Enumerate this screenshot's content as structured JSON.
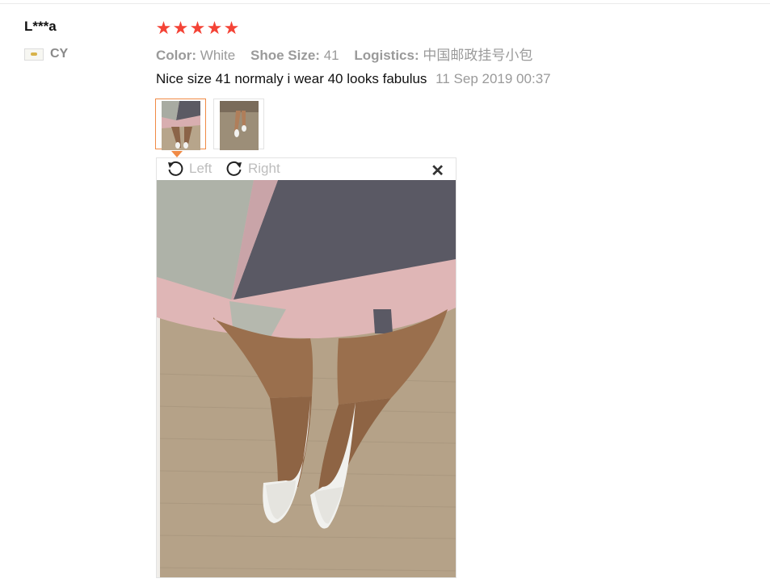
{
  "review": {
    "user": {
      "name": "L***a",
      "country": "CY",
      "flag_icon": "flag-icon"
    },
    "rating": {
      "stars": 5,
      "max": 5,
      "color": "#f44336"
    },
    "attributes": [
      {
        "key": "Color:",
        "value": "White"
      },
      {
        "key": "Shoe Size:",
        "value": "41"
      },
      {
        "key": "Logistics:",
        "value": "中国邮政挂号小包"
      }
    ],
    "text": "Nice size 41 normaly i wear 40 looks fabulus",
    "date": "11 Sep 2019 00:37",
    "thumbnails": [
      {
        "name": "photo-1",
        "active": true
      },
      {
        "name": "photo-2",
        "active": false
      }
    ],
    "viewer": {
      "rotate_left_label": "Left",
      "rotate_right_label": "Right",
      "close_icon": "close-icon"
    }
  },
  "colors": {
    "accent": "#f08a45",
    "muted": "#9a9a9a",
    "star": "#f44336"
  }
}
